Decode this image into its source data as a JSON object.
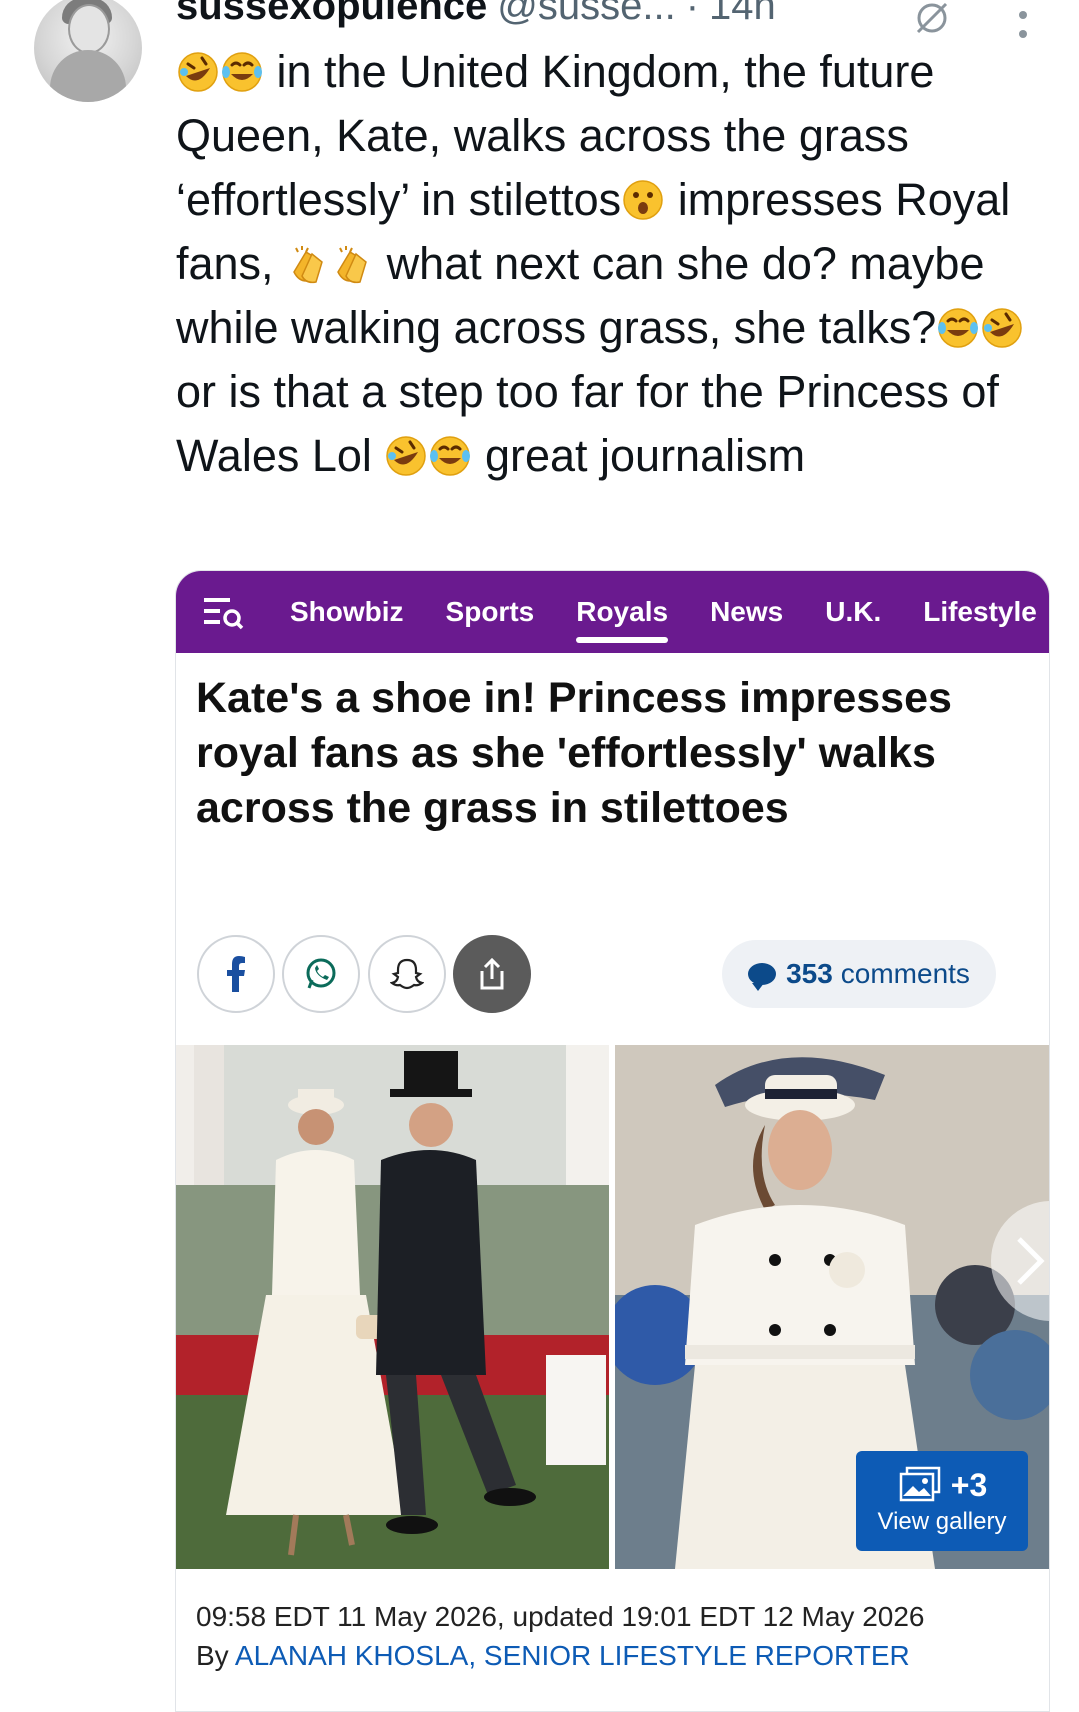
{
  "tweet": {
    "display_name": "sussexopulence",
    "handle": "@susse...",
    "separator": "·",
    "time": "14h",
    "text_parts": [
      "in the United Kingdom, the future Queen, Kate, walks across the grass ‘effortlessly’ in stilettos",
      "impresses Royal fans,",
      "what next can she do? maybe while walking across grass, she talks?",
      "or is that a step too far for the Princess of Wales Lol",
      "great journalism"
    ],
    "emojis": [
      "rolling-on-floor-laughing",
      "tears-of-joy",
      "astonished-face",
      "clapping-hands"
    ]
  },
  "article": {
    "nav": {
      "items": [
        "Showbiz",
        "Sports",
        "Royals",
        "News",
        "U.K.",
        "Lifestyle"
      ],
      "active": "Royals"
    },
    "headline": "Kate's a shoe in! Princess impresses royal fans as she 'effortlessly' walks across the grass in stilettoes",
    "share_buttons": [
      "facebook-icon",
      "whatsapp-icon",
      "snapchat-icon",
      "share-icon"
    ],
    "comments_count": "353",
    "comments_label": "comments",
    "gallery": {
      "extra": "+3",
      "label": "View gallery"
    },
    "dateline": "09:58 EDT 11 May 2026, updated 19:01 EDT 12 May 2026",
    "byline_prefix": "By",
    "author": "ALANAH KHOSLA, SENIOR LIFESTYLE REPORTER"
  },
  "colors": {
    "nav_bg": "#6a1a8f",
    "accent_blue": "#0d5bb5",
    "text_primary": "#0f1419",
    "text_secondary": "#536471"
  }
}
